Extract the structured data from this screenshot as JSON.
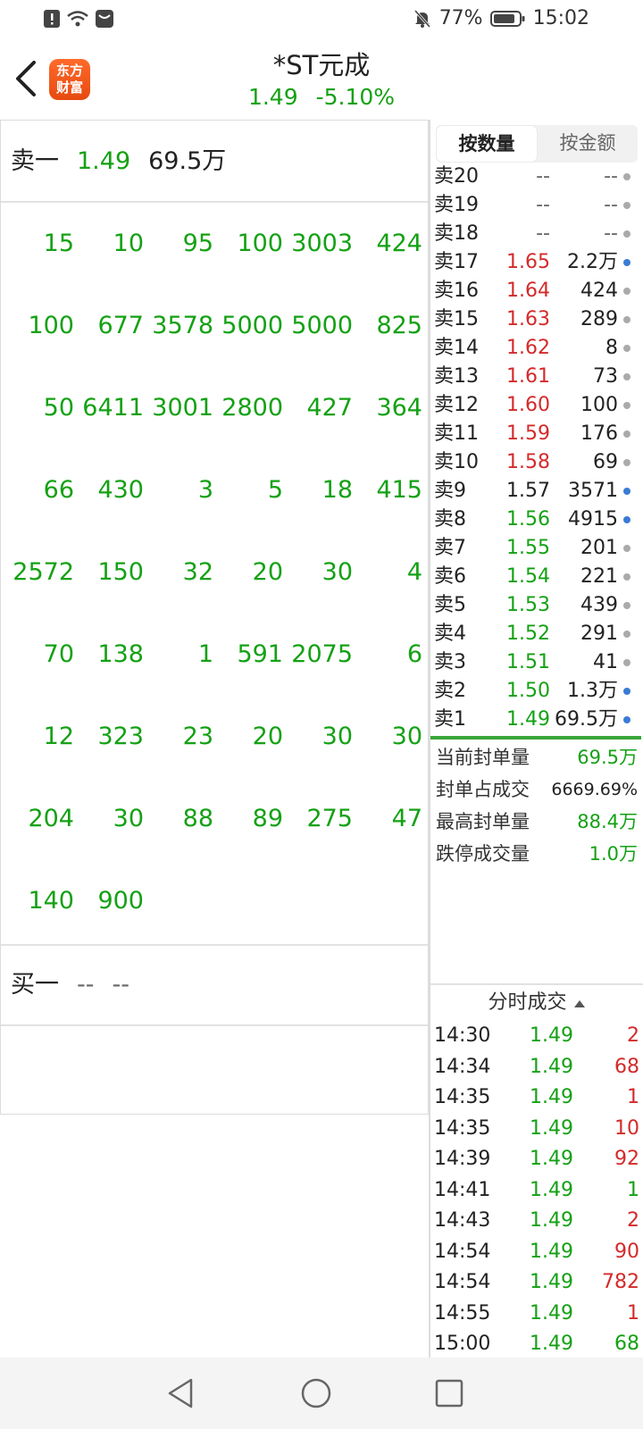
{
  "status_bar": {
    "battery": "77%",
    "time": "15:02"
  },
  "header": {
    "title": "*ST元成",
    "price": "1.49",
    "change": "-5.10%",
    "logo_line1": "东方",
    "logo_line2": "财富"
  },
  "colors": {
    "green": "#14a114",
    "red": "#d42a2a",
    "blue_dot": "#3a7bd5",
    "gray_dot": "#aaaaaa"
  },
  "ask1": {
    "label": "卖一",
    "price": "1.49",
    "volume": "69.5万"
  },
  "queue_grid": [
    [
      "15",
      "10",
      "95",
      "100",
      "3003",
      "424"
    ],
    [
      "100",
      "677",
      "3578",
      "5000",
      "5000",
      "825"
    ],
    [
      "50",
      "6411",
      "3001",
      "2800",
      "427",
      "364"
    ],
    [
      "66",
      "430",
      "3",
      "5",
      "18",
      "415"
    ],
    [
      "2572",
      "150",
      "32",
      "20",
      "30",
      "4"
    ],
    [
      "70",
      "138",
      "1",
      "591",
      "2075",
      "6"
    ],
    [
      "12",
      "323",
      "23",
      "20",
      "30",
      "30"
    ],
    [
      "204",
      "30",
      "88",
      "89",
      "275",
      "47"
    ],
    [
      "140",
      "900",
      "",
      "",
      "",
      ""
    ]
  ],
  "bid1": {
    "label": "买一",
    "price": "--",
    "volume": "--"
  },
  "tabs": [
    {
      "label": "按数量",
      "active": true
    },
    {
      "label": "按金额",
      "active": false
    }
  ],
  "order_book": [
    {
      "label": "卖20",
      "price": "--",
      "volume": "--",
      "price_color": "gray",
      "dot": "gray"
    },
    {
      "label": "卖19",
      "price": "--",
      "volume": "--",
      "price_color": "gray",
      "dot": "gray"
    },
    {
      "label": "卖18",
      "price": "--",
      "volume": "--",
      "price_color": "gray",
      "dot": "gray"
    },
    {
      "label": "卖17",
      "price": "1.65",
      "volume": "2.2万",
      "price_color": "red",
      "dot": "blue"
    },
    {
      "label": "卖16",
      "price": "1.64",
      "volume": "424",
      "price_color": "red",
      "dot": "gray"
    },
    {
      "label": "卖15",
      "price": "1.63",
      "volume": "289",
      "price_color": "red",
      "dot": "gray"
    },
    {
      "label": "卖14",
      "price": "1.62",
      "volume": "8",
      "price_color": "red",
      "dot": "gray"
    },
    {
      "label": "卖13",
      "price": "1.61",
      "volume": "73",
      "price_color": "red",
      "dot": "gray"
    },
    {
      "label": "卖12",
      "price": "1.60",
      "volume": "100",
      "price_color": "red",
      "dot": "gray"
    },
    {
      "label": "卖11",
      "price": "1.59",
      "volume": "176",
      "price_color": "red",
      "dot": "gray"
    },
    {
      "label": "卖10",
      "price": "1.58",
      "volume": "69",
      "price_color": "red",
      "dot": "gray"
    },
    {
      "label": "卖9",
      "price": "1.57",
      "volume": "3571",
      "price_color": "dark",
      "dot": "blue"
    },
    {
      "label": "卖8",
      "price": "1.56",
      "volume": "4915",
      "price_color": "green",
      "dot": "blue"
    },
    {
      "label": "卖7",
      "price": "1.55",
      "volume": "201",
      "price_color": "green",
      "dot": "gray"
    },
    {
      "label": "卖6",
      "price": "1.54",
      "volume": "221",
      "price_color": "green",
      "dot": "gray"
    },
    {
      "label": "卖5",
      "price": "1.53",
      "volume": "439",
      "price_color": "green",
      "dot": "gray"
    },
    {
      "label": "卖4",
      "price": "1.52",
      "volume": "291",
      "price_color": "green",
      "dot": "gray"
    },
    {
      "label": "卖3",
      "price": "1.51",
      "volume": "41",
      "price_color": "green",
      "dot": "gray"
    },
    {
      "label": "卖2",
      "price": "1.50",
      "volume": "1.3万",
      "price_color": "green",
      "dot": "blue"
    },
    {
      "label": "卖1",
      "price": "1.49",
      "volume": "69.5万",
      "price_color": "green",
      "dot": "blue"
    }
  ],
  "stats": [
    {
      "label": "当前封单量",
      "value": "69.5万"
    },
    {
      "label": "封单占成交",
      "value": "6669.69%"
    },
    {
      "label": "最高封单量",
      "value": "88.4万"
    },
    {
      "label": "跌停成交量",
      "value": "1.0万"
    }
  ],
  "trades_header": "分时成交",
  "trades": [
    {
      "time": "14:30",
      "price": "1.49",
      "volume": "2",
      "vcolor": "red"
    },
    {
      "time": "14:34",
      "price": "1.49",
      "volume": "68",
      "vcolor": "red"
    },
    {
      "time": "14:35",
      "price": "1.49",
      "volume": "1",
      "vcolor": "red"
    },
    {
      "time": "14:35",
      "price": "1.49",
      "volume": "10",
      "vcolor": "red"
    },
    {
      "time": "14:39",
      "price": "1.49",
      "volume": "92",
      "vcolor": "red"
    },
    {
      "time": "14:41",
      "price": "1.49",
      "volume": "1",
      "vcolor": "green"
    },
    {
      "time": "14:43",
      "price": "1.49",
      "volume": "2",
      "vcolor": "red"
    },
    {
      "time": "14:54",
      "price": "1.49",
      "volume": "90",
      "vcolor": "red"
    },
    {
      "time": "14:54",
      "price": "1.49",
      "volume": "782",
      "vcolor": "red"
    },
    {
      "time": "14:55",
      "price": "1.49",
      "volume": "1",
      "vcolor": "red"
    },
    {
      "time": "15:00",
      "price": "1.49",
      "volume": "68",
      "vcolor": "green"
    }
  ]
}
